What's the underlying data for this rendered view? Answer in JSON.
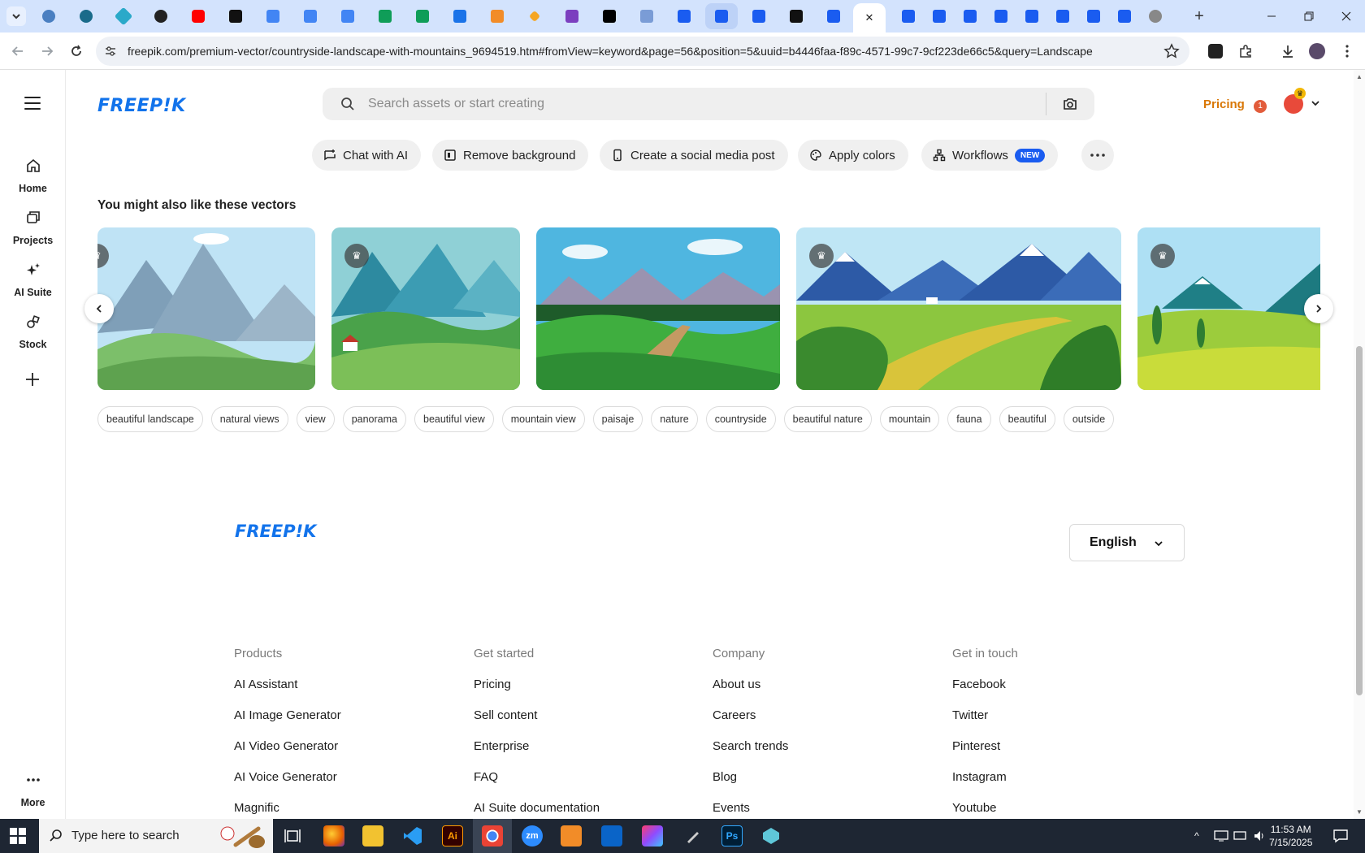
{
  "browser": {
    "url": "freepik.com/premium-vector/countryside-landscape-with-mountains_9694519.htm#fromView=keyword&page=56&position=5&uuid=b4446faa-f89c-4571-99c7-9cf223de66c5&query=Landscape",
    "tab_close_glyph": "✕",
    "new_tab_glyph": "+"
  },
  "sidebar": {
    "items": [
      {
        "label": "Home",
        "icon": "home-icon"
      },
      {
        "label": "Projects",
        "icon": "projects-icon"
      },
      {
        "label": "AI Suite",
        "icon": "sparkle-icon"
      },
      {
        "label": "Stock",
        "icon": "stock-icon"
      }
    ],
    "more_label": "More"
  },
  "header": {
    "logo": "FREEP!K",
    "search_placeholder": "Search assets or start creating",
    "pricing": "Pricing",
    "notification_count": "1"
  },
  "tools": [
    {
      "label": "Chat with AI"
    },
    {
      "label": "Remove background"
    },
    {
      "label": "Create a social media post"
    },
    {
      "label": "Apply colors"
    },
    {
      "label": "Workflows",
      "badge": "NEW"
    }
  ],
  "section": {
    "title": "You might also like these vectors"
  },
  "tags": [
    "beautiful landscape",
    "natural views",
    "view",
    "panorama",
    "beautiful view",
    "mountain view",
    "paisaje",
    "nature",
    "countryside",
    "beautiful nature",
    "mountain",
    "fauna",
    "beautiful",
    "outside"
  ],
  "footer": {
    "logo": "FREEP!K",
    "language": "English",
    "columns": [
      {
        "heading": "Products",
        "links": [
          "AI Assistant",
          "AI Image Generator",
          "AI Video Generator",
          "AI Voice Generator",
          "Magnific"
        ]
      },
      {
        "heading": "Get started",
        "links": [
          "Pricing",
          "Sell content",
          "Enterprise",
          "FAQ",
          "AI Suite documentation"
        ]
      },
      {
        "heading": "Company",
        "links": [
          "About us",
          "Careers",
          "Search trends",
          "Blog",
          "Events"
        ]
      },
      {
        "heading": "Get in touch",
        "links": [
          "Facebook",
          "Twitter",
          "Pinterest",
          "Instagram",
          "Youtube"
        ]
      }
    ]
  },
  "taskbar": {
    "search_text": "Type here to search",
    "time": "11:53 AM",
    "date": "7/15/2025",
    "apps": [
      "Ai",
      "Ps"
    ]
  },
  "colors": {
    "brand_blue": "#1273eb",
    "pricing_orange": "#d97706",
    "new_badge": "#1a5cf0"
  }
}
